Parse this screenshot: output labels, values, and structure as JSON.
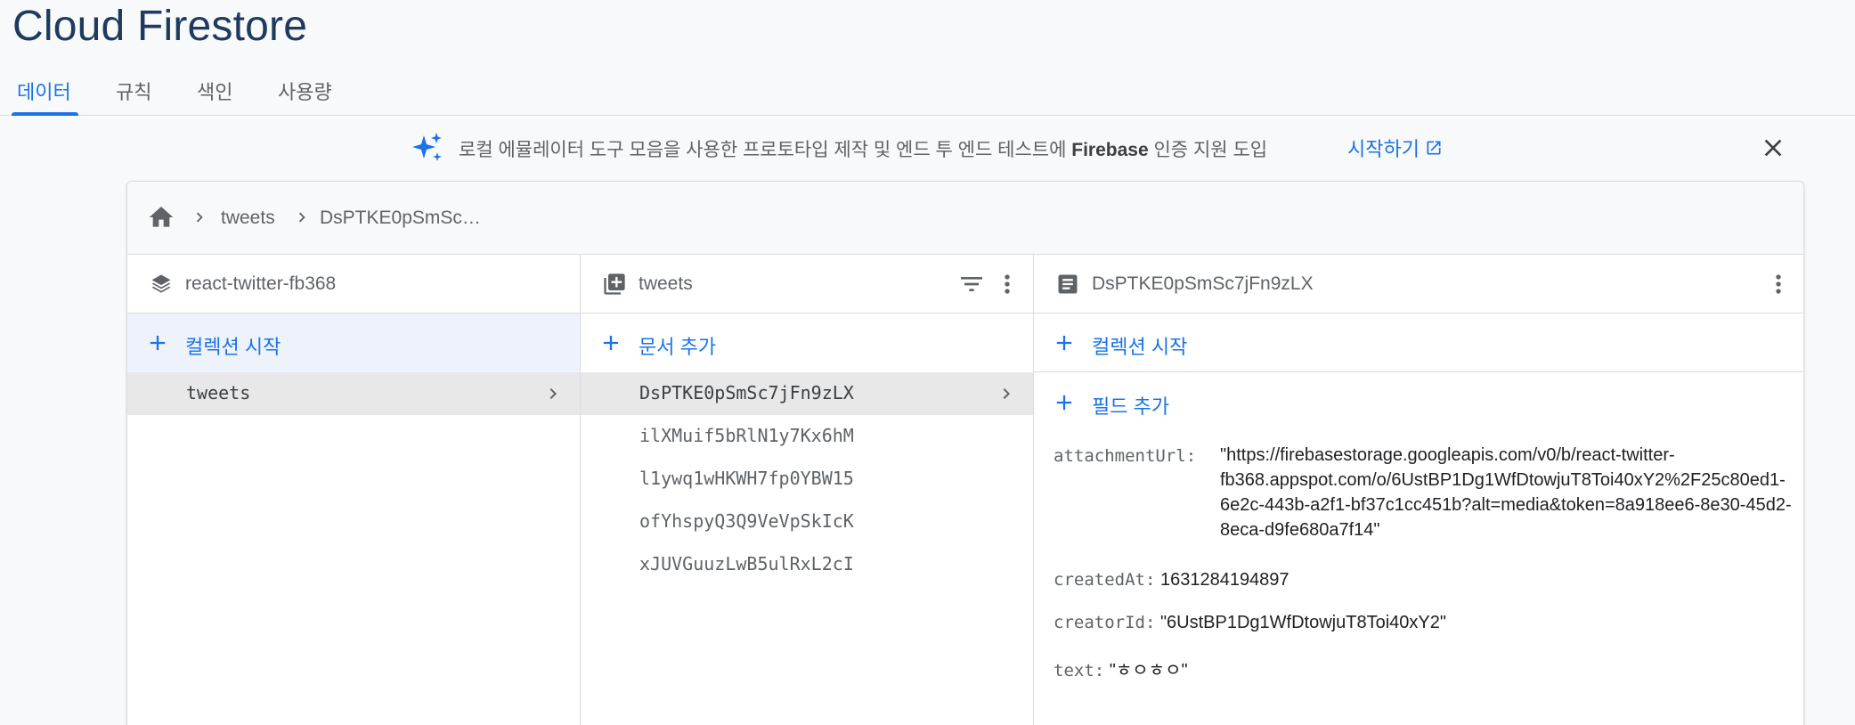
{
  "app_title": "Cloud Firestore",
  "tabs": [
    {
      "label": "데이터",
      "active": true
    },
    {
      "label": "규칙",
      "active": false
    },
    {
      "label": "색인",
      "active": false
    },
    {
      "label": "사용량",
      "active": false
    }
  ],
  "banner": {
    "text_before": "로컬 에뮬레이터 도구 모음을 사용한 프로토타입 제작 및 엔드 투 엔드 테스트에 ",
    "text_bold": "Firebase",
    "text_after": " 인증 지원 도입",
    "link_label": "시작하기",
    "icon": "sparkle-icon"
  },
  "breadcrumb": {
    "items": [
      "tweets",
      "DsPTKE0pSmSc…"
    ]
  },
  "columns": {
    "root": {
      "title": "react-twitter-fb368",
      "add_label": "컬렉션 시작",
      "items": [
        "tweets"
      ]
    },
    "collection": {
      "title": "tweets",
      "add_label": "문서 추가",
      "items": [
        "DsPTKE0pSmSc7jFn9zLX",
        "ilXMuif5bRlN1y7Kx6hM",
        "l1ywq1wHKWH7fp0YBW15",
        "ofYhspyQ3Q9VeVpSkIcK",
        "xJUVGuuzLwB5ulRxL2cI"
      ]
    },
    "document": {
      "title": "DsPTKE0pSmSc7jFn9zLX",
      "add_collection_label": "컬렉션 시작",
      "add_field_label": "필드 추가",
      "fields": {
        "attachmentUrl_key": "attachmentUrl:",
        "attachmentUrl_lines": [
          "\"https://firebasestorage.googleapis.com/v0/b/react-twitter-",
          "fb368.appspot.com/o/6UstBP1Dg1WfDtowjuT8Toi40xY2%2F25c80ed1-",
          "6e2c-443b-a2f1-bf37c1cc451b?alt=media&token=8a918ee6-8e30-45d2-",
          "8eca-d9fe680a7f14\""
        ],
        "createdAt_key": "createdAt:",
        "createdAt_value": "1631284194897",
        "creatorId_key": "creatorId:",
        "creatorId_value": "\"6UstBP1Dg1WfDtowjuT8Toi40xY2\"",
        "text_key": "text:",
        "text_value": "\"ㅎㅇㅎㅇ\""
      }
    }
  },
  "colors": {
    "accent": "#1a73e8",
    "title": "#1f3a60"
  }
}
